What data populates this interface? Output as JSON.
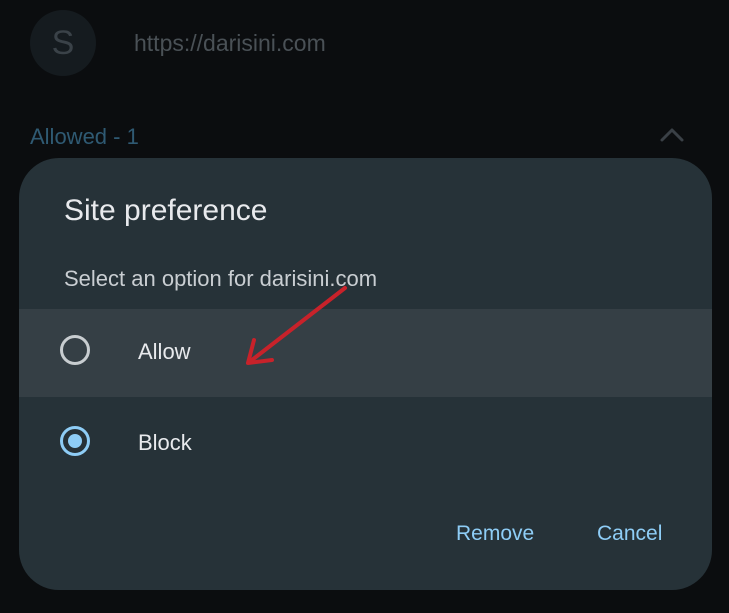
{
  "background": {
    "avatar_letter": "S",
    "site_url": "https://darisini.com",
    "section_header": "Allowed - 1"
  },
  "dialog": {
    "title": "Site preference",
    "subtitle": "Select an option for darisini.com",
    "options": [
      {
        "label": "Allow",
        "selected": false
      },
      {
        "label": "Block",
        "selected": true
      }
    ],
    "remove_label": "Remove",
    "cancel_label": "Cancel"
  },
  "colors": {
    "accent": "#8ecdf6",
    "dialog_bg": "#263238",
    "annotation_arrow": "#c8222a"
  }
}
